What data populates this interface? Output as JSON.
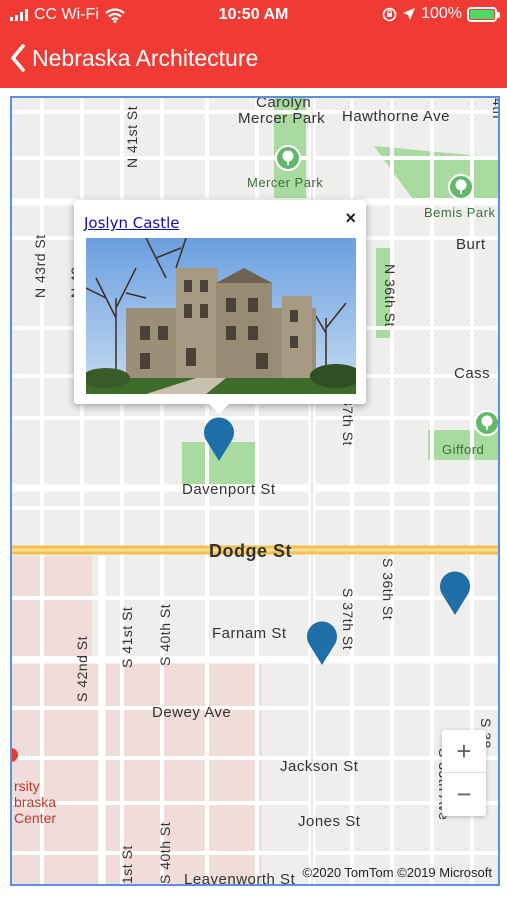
{
  "status_bar": {
    "carrier": "CC Wi-Fi",
    "time": "10:50 AM",
    "battery": "100%",
    "battery_level": 1.0
  },
  "nav": {
    "title": "Nebraska Architecture"
  },
  "map": {
    "street_labels": {
      "carolyn": "Carolyn",
      "mercer_park_rd": "Mercer Park",
      "hawthorne": "Hawthorne Ave",
      "mercer_park": "Mercer Park",
      "bemis_park": "Bemis Park",
      "burt": "Burt",
      "cass": "Cass",
      "gifford": "Gifford",
      "davenport": "Davenport St",
      "dodge": "Dodge St",
      "farnam": "Farnam St",
      "dewey": "Dewey Ave",
      "jackson": "Jackson St",
      "jones": "Jones St",
      "leavenworth": "Leavenworth St",
      "n41": "N 41st St",
      "n43": "N 43rd St",
      "n42": "N 42",
      "n36": "N 36th St",
      "s37th_top": "37th St",
      "s42": "S 42nd St",
      "s41": "S 41st St",
      "s40": "S 40th St",
      "s37": "S 37th St",
      "s36": "S 36th St",
      "s35_ave": "S 35th Ave",
      "s38": "S 38",
      "st1": "1st St",
      "s40b": "S 40th St",
      "th4": "4th",
      "campus_1": "rsity",
      "campus_2": "braska",
      "campus_3": "Center"
    },
    "popup": {
      "title": "Joslyn Castle",
      "close": "×"
    },
    "zoom": {
      "in": "+",
      "out": "−"
    },
    "attribution": "©2020 TomTom ©2019 Microsoft"
  },
  "colors": {
    "header": "#ef3b33",
    "pin": "#1f6fa8",
    "highway": "#f2c14e",
    "park": "#a9dba0",
    "campus": "#f0dcd8"
  }
}
